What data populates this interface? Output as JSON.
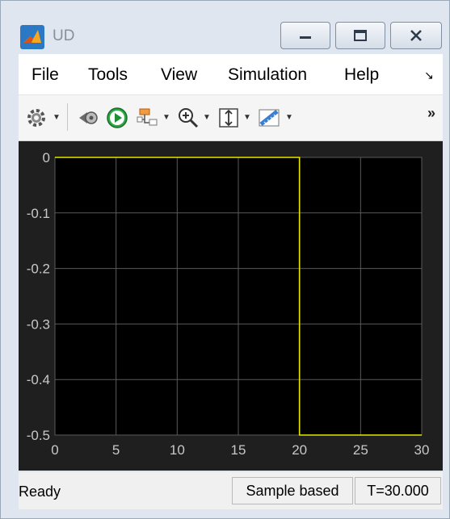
{
  "window": {
    "title": "UD",
    "buttons": {
      "minimize": "minimize-icon",
      "maximize": "maximize-icon",
      "close": "close-icon"
    }
  },
  "menu": {
    "items": [
      "File",
      "Tools",
      "View",
      "Simulation",
      "Help"
    ],
    "overflow_icon": "menu-overflow-icon"
  },
  "toolbar": {
    "icons": [
      "settings-icon",
      "step-back-icon",
      "run-icon",
      "signal-icon",
      "zoom-icon",
      "scale-icon",
      "measure-icon"
    ],
    "overflow": "»"
  },
  "colors": {
    "plot_background": "#000000",
    "plot_frame": "#1f1f1f",
    "grid": "#5a5a5a",
    "signal": "#e6e600",
    "tick_label": "#c8c8c8"
  },
  "chart_data": {
    "type": "line",
    "title": "",
    "xlabel": "",
    "ylabel": "",
    "xlim": [
      0,
      30
    ],
    "ylim": [
      -0.5,
      0
    ],
    "x_ticks": [
      "0",
      "5",
      "10",
      "15",
      "20",
      "25",
      "30"
    ],
    "y_ticks": [
      "0",
      "-0.1",
      "-0.2",
      "-0.3",
      "-0.4",
      "-0.5"
    ],
    "grid": true,
    "series": [
      {
        "points": [
          [
            0,
            0
          ],
          [
            20,
            0
          ],
          [
            20,
            -0.5
          ],
          [
            30,
            -0.5
          ]
        ]
      }
    ]
  },
  "status": {
    "state": "Ready",
    "mode": "Sample based",
    "time": "T=30.000"
  }
}
